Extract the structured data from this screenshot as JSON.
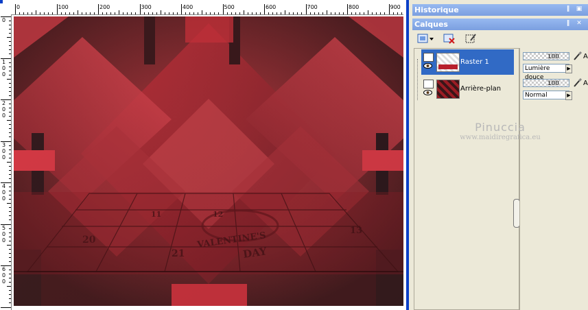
{
  "ruler": {
    "h_labels": [
      "0",
      "100",
      "200",
      "300",
      "400",
      "500",
      "600",
      "700",
      "800",
      "900"
    ],
    "v_labels": [
      [
        "0"
      ],
      [
        "1",
        "0",
        "0"
      ],
      [
        "2",
        "0",
        "0"
      ],
      [
        "3",
        "0",
        "0"
      ],
      [
        "4",
        "0",
        "0"
      ],
      [
        "5",
        "0",
        "0"
      ],
      [
        "6",
        "0",
        "0"
      ]
    ]
  },
  "canvas": {
    "artwork_text": [
      "20",
      "21",
      "11",
      "12",
      "13",
      "VALENTINE'S",
      "DAY"
    ]
  },
  "palettes": {
    "historique": {
      "title": "Historique"
    },
    "calques": {
      "title": "Calques"
    }
  },
  "layers": [
    {
      "name": "Raster 1",
      "selected": true,
      "opacity": "100",
      "blend": "Lumière douce"
    },
    {
      "name": "Arrière-plan",
      "selected": false,
      "opacity": "100",
      "blend": "Normal"
    }
  ],
  "watermark": {
    "name": "Pinuccia",
    "url": "www.maidiregrafica.eu"
  },
  "props_letter": "A",
  "colors": {
    "selection": "#316ac5",
    "palette_title": "#7b9fe0",
    "window_blue": "#0b3fc7"
  },
  "icons": [
    "new-layer-icon",
    "delete-layer-icon",
    "mask-selection-icon",
    "visibility-eye-icon",
    "brush-icon"
  ]
}
